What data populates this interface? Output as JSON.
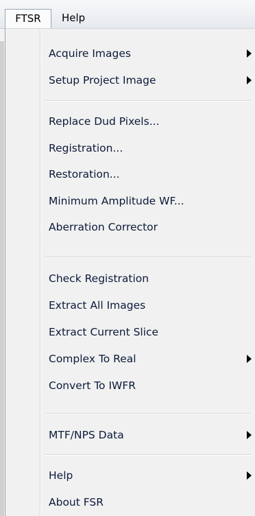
{
  "menubar": {
    "items": [
      {
        "label": "FTSR"
      },
      {
        "label": "Help"
      }
    ]
  },
  "menu": {
    "items": [
      {
        "label": "Acquire Images",
        "submenu": true
      },
      {
        "label": "Setup Project Image",
        "submenu": true
      },
      {
        "label": "Replace Dud Pixels...",
        "submenu": false
      },
      {
        "label": "Registration...",
        "submenu": false
      },
      {
        "label": "Restoration...",
        "submenu": false
      },
      {
        "label": "Minimum Amplitude WF...",
        "submenu": false
      },
      {
        "label": "Aberration Corrector",
        "submenu": false
      },
      {
        "label": "Check Registration",
        "submenu": false
      },
      {
        "label": "Extract All Images",
        "submenu": false
      },
      {
        "label": "Extract Current Slice",
        "submenu": false
      },
      {
        "label": "Complex To Real",
        "submenu": true
      },
      {
        "label": "Convert To IWFR",
        "submenu": false
      },
      {
        "label": "MTF/NPS Data",
        "submenu": true
      },
      {
        "label": "Help",
        "submenu": true
      },
      {
        "label": "About FSR",
        "submenu": false
      }
    ]
  }
}
